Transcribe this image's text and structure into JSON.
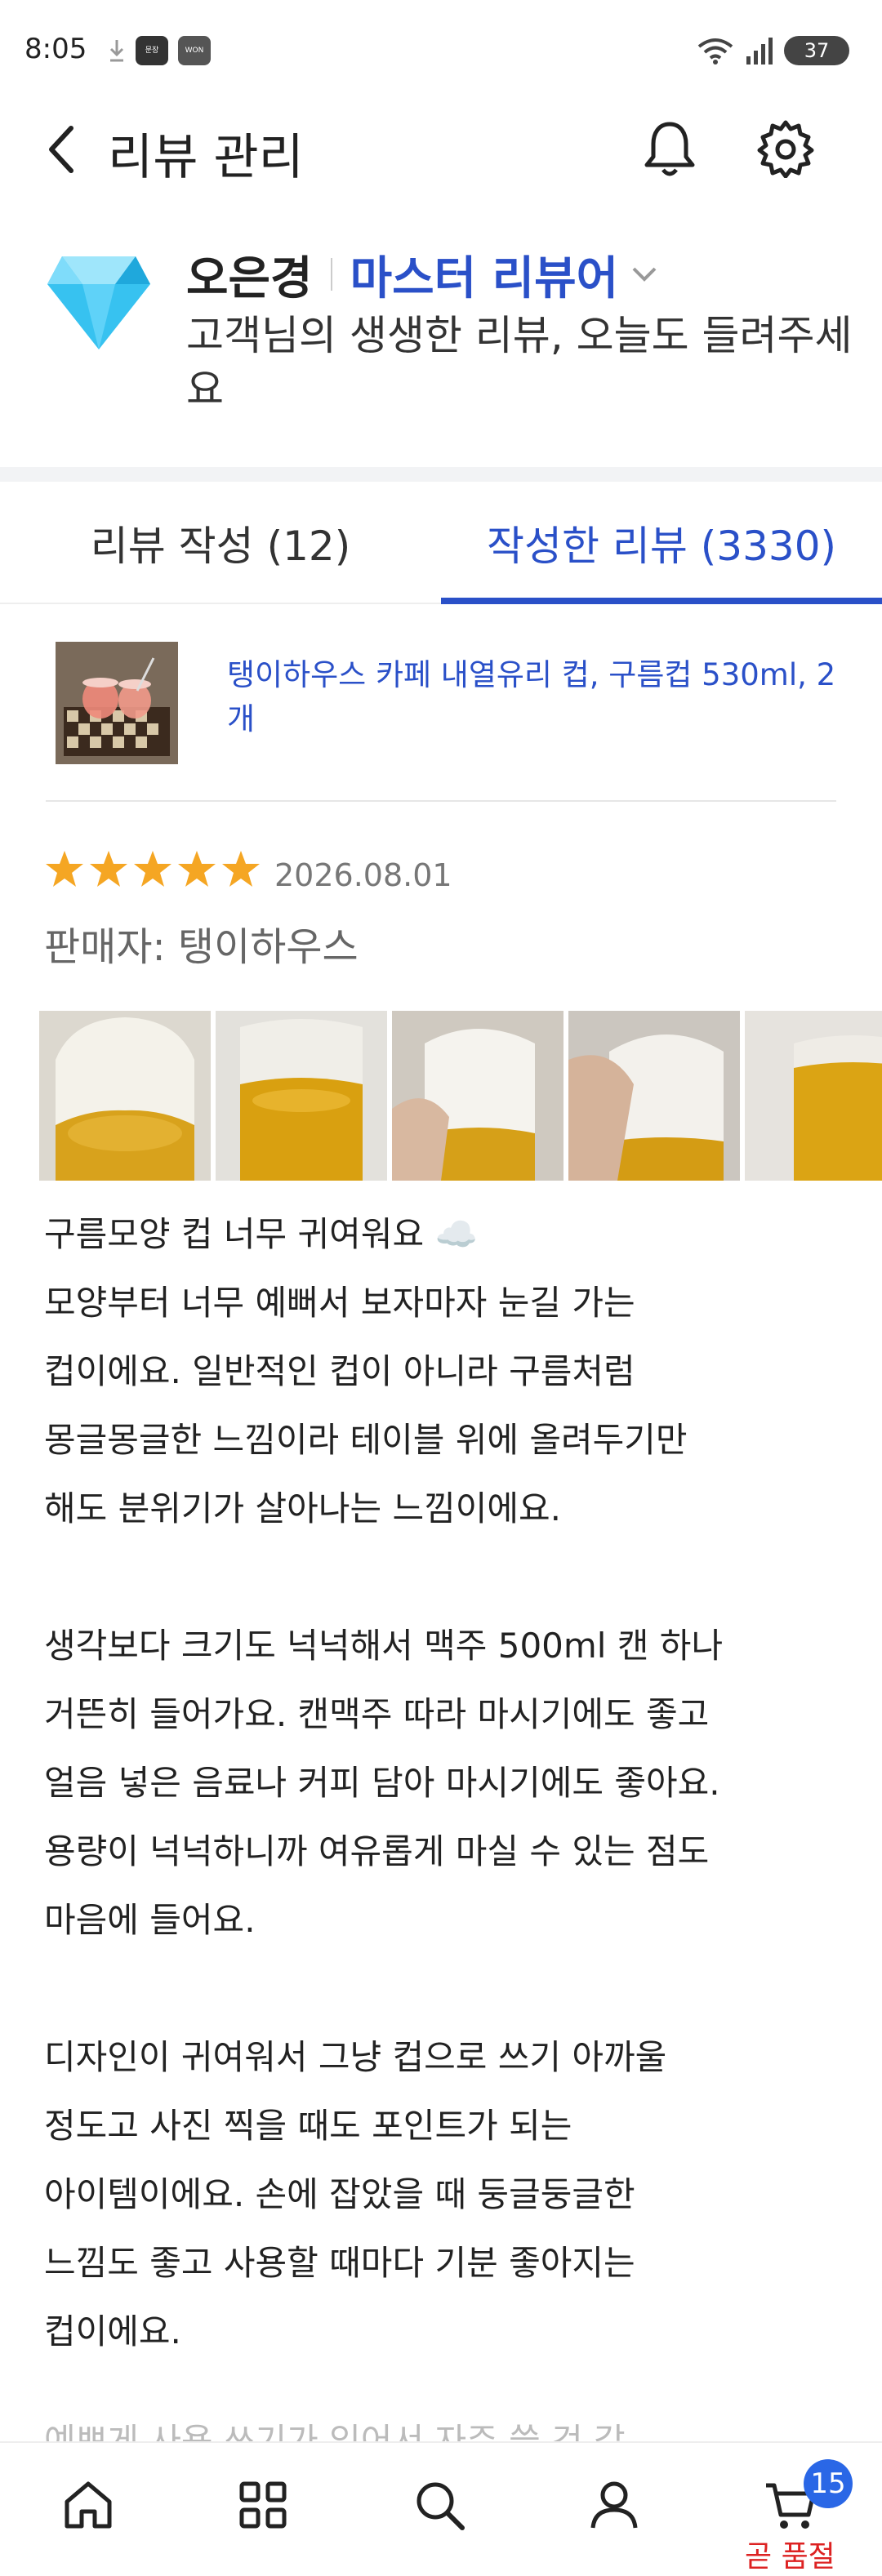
{
  "status_bar": {
    "time": "8:05",
    "app_icon_1": "문장",
    "app_icon_2": "WON",
    "battery": "37"
  },
  "header": {
    "title": "리뷰 관리"
  },
  "profile": {
    "name": "오은경",
    "grade": "마스터 리뷰어",
    "message": "고객님의 생생한 리뷰, 오늘도 들려주세요"
  },
  "tabs": [
    {
      "label": "리뷰 작성 (12)",
      "active": false
    },
    {
      "label": "작성한 리뷰 (3330)",
      "active": true
    }
  ],
  "product": {
    "name": "탱이하우스 카페 내열유리 컵, 구름컵 530ml, 2개"
  },
  "review": {
    "rating": 5,
    "date": "2026.08.01",
    "seller": "판매자: 탱이하우스",
    "photo_count": 5,
    "body": "구름모양 컵 너무 귀여워요 ☁️\n모양부터 너무 예뻐서 보자마자 눈길 가는\n컵이에요. 일반적인 컵이 아니라 구름처럼\n몽글몽글한 느낌이라 테이블 위에 올려두기만\n해도 분위기가 살아나는 느낌이에요.\n\n생각보다 크기도 넉넉해서 맥주 500ml 캔 하나\n거뜬히 들어가요. 캔맥주 따라 마시기에도 좋고\n얼음 넣은 음료나 커피 담아 마시기에도 좋아요.\n용량이 넉넉하니까 여유롭게 마실 수 있는 점도\n마음에 들어요.\n\n디자인이 귀여워서 그냥 컵으로 쓰기 아까울\n정도고 사진 찍을 때도 포인트가 되는\n아이템이에요. 손에 잡았을 때 둥글둥글한\n느낌도 좋고 사용할 때마다 기분 좋아지는\n컵이에요.",
    "cutoff_line": "예쁘게 사용 쓰기가 있어서 자주 쓸 것 같"
  },
  "bottom_nav": {
    "items": [
      "home-icon",
      "grid-icon",
      "search-icon",
      "person-icon",
      "cart-icon"
    ],
    "cart_badge": "15",
    "cart_note": "곧 품절"
  },
  "colors": {
    "accent": "#2a50c8",
    "star": "#f5a623",
    "badge": "#2a67e6",
    "soldout": "#d22222"
  }
}
